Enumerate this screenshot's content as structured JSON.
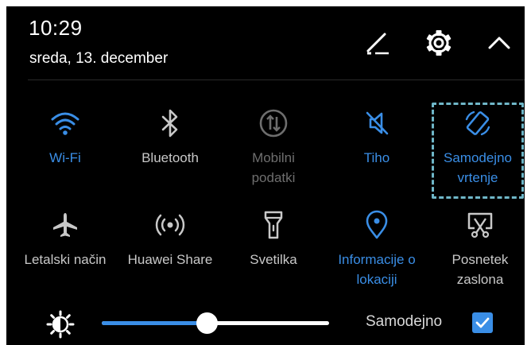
{
  "header": {
    "time": "10:29",
    "date": "sreda, 13. december",
    "edit_icon": "pencil-edit-icon",
    "settings_icon": "gear-icon",
    "collapse_icon": "chevron-up-icon"
  },
  "tiles": [
    {
      "label": "Wi-Fi",
      "icon": "wifi-icon",
      "state": "on"
    },
    {
      "label": "Bluetooth",
      "icon": "bluetooth-icon",
      "state": "off"
    },
    {
      "label": "Mobilni podatki",
      "icon": "mobile-data-icon",
      "state": "disabled"
    },
    {
      "label": "Tiho",
      "icon": "mute-icon",
      "state": "on"
    },
    {
      "label": "Samodejno vrtenje",
      "icon": "auto-rotate-icon",
      "state": "on"
    },
    {
      "label": "Letalski način",
      "icon": "airplane-icon",
      "state": "off"
    },
    {
      "label": "Huawei Share",
      "icon": "huawei-share-icon",
      "state": "off"
    },
    {
      "label": "Svetilka",
      "icon": "flashlight-icon",
      "state": "off"
    },
    {
      "label": "Informacije o lokaciji",
      "icon": "location-icon",
      "state": "on"
    },
    {
      "label": "Posnetek zaslona",
      "icon": "screenshot-icon",
      "state": "off"
    }
  ],
  "brightness": {
    "icon": "brightness-icon",
    "level": 0.46,
    "auto_label": "Samodejno",
    "auto_checked": true
  },
  "colors": {
    "accent": "#3a8ee6",
    "background": "#000000",
    "label_off": "#c8c8c8",
    "label_disabled": "#6e6e6e",
    "highlight_border": "#6fb7c8"
  }
}
